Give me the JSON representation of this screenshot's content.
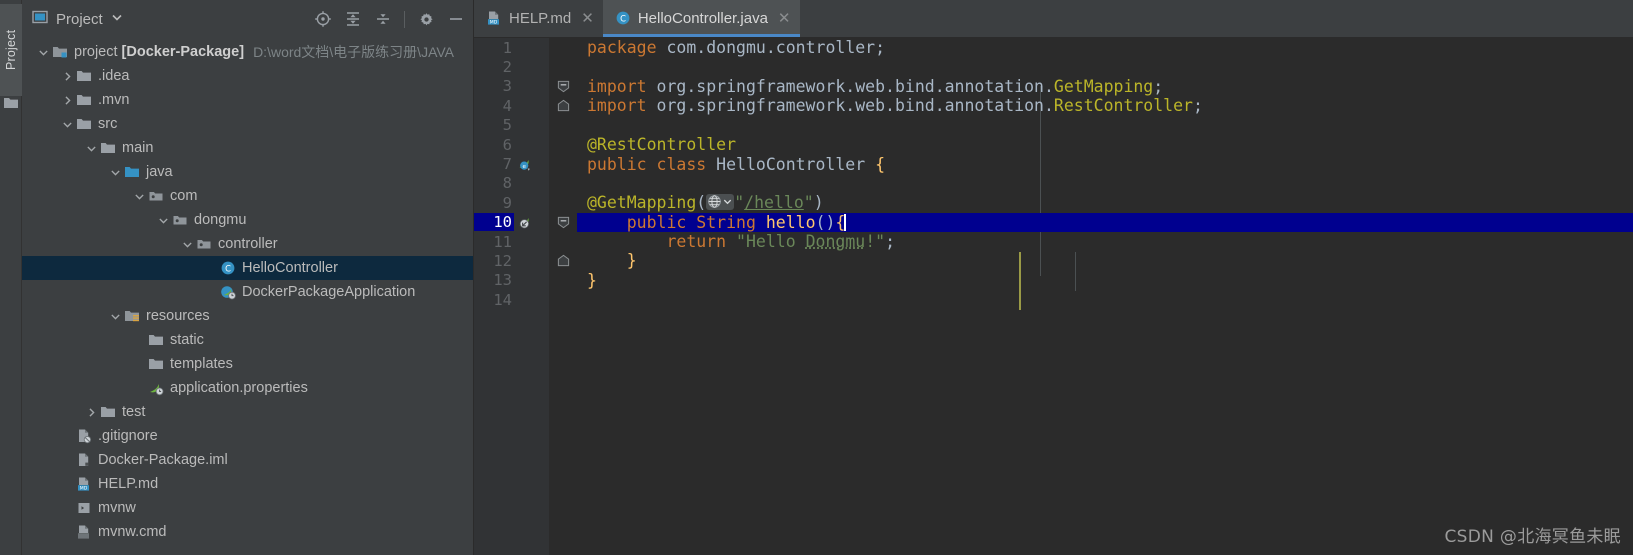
{
  "tool_strip": {
    "label": "Project",
    "icon": "folder-icon"
  },
  "panel": {
    "title": "Project",
    "title_icon": "project-view-icon",
    "dropdown_icon": "chevron-down-icon",
    "toolbar": [
      {
        "name": "locate-file-icon",
        "tip": "Select Opened File"
      },
      {
        "name": "expand-all-icon",
        "tip": "Expand All"
      },
      {
        "name": "collapse-all-icon",
        "tip": "Collapse All"
      },
      {
        "name": "settings-gear-icon",
        "tip": "Settings"
      },
      {
        "name": "hide-panel-icon",
        "tip": "Hide"
      }
    ]
  },
  "tree": [
    {
      "indent": 0,
      "arrow": "down",
      "icon": "module-icon",
      "label": "project",
      "bold": "[Docker-Package]",
      "sub": "D:\\word文档\\电子版练习册\\JAVA",
      "selected": false
    },
    {
      "indent": 1,
      "arrow": "right",
      "icon": "folder-icon",
      "label": ".idea",
      "selected": false
    },
    {
      "indent": 1,
      "arrow": "right",
      "icon": "folder-icon",
      "label": ".mvn",
      "selected": false
    },
    {
      "indent": 1,
      "arrow": "down",
      "icon": "folder-icon",
      "label": "src",
      "selected": false
    },
    {
      "indent": 2,
      "arrow": "down",
      "icon": "folder-icon",
      "label": "main",
      "selected": false
    },
    {
      "indent": 3,
      "arrow": "down",
      "icon": "source-root-icon",
      "label": "java",
      "selected": false
    },
    {
      "indent": 4,
      "arrow": "down",
      "icon": "package-icon",
      "label": "com",
      "selected": false
    },
    {
      "indent": 5,
      "arrow": "down",
      "icon": "package-icon",
      "label": "dongmu",
      "selected": false
    },
    {
      "indent": 6,
      "arrow": "down",
      "icon": "package-icon",
      "label": "controller",
      "selected": false
    },
    {
      "indent": 7,
      "arrow": "none",
      "icon": "java-class-icon",
      "label": "HelloController",
      "selected": true
    },
    {
      "indent": 7,
      "arrow": "none",
      "icon": "spring-boot-class-icon",
      "label": "DockerPackageApplication",
      "selected": false
    },
    {
      "indent": 3,
      "arrow": "down",
      "icon": "resource-root-icon",
      "label": "resources",
      "selected": false
    },
    {
      "indent": 4,
      "arrow": "none",
      "icon": "folder-icon",
      "label": "static",
      "selected": false
    },
    {
      "indent": 4,
      "arrow": "none",
      "icon": "folder-icon",
      "label": "templates",
      "selected": false
    },
    {
      "indent": 4,
      "arrow": "none",
      "icon": "spring-properties-icon",
      "label": "application.properties",
      "selected": false
    },
    {
      "indent": 2,
      "arrow": "right",
      "icon": "folder-icon",
      "label": "test",
      "selected": false
    },
    {
      "indent": 1,
      "arrow": "none",
      "icon": "gitignore-file-icon",
      "label": ".gitignore",
      "selected": false
    },
    {
      "indent": 1,
      "arrow": "none",
      "icon": "iml-file-icon",
      "label": "Docker-Package.iml",
      "selected": false
    },
    {
      "indent": 1,
      "arrow": "none",
      "icon": "markdown-file-icon",
      "label": "HELP.md",
      "selected": false
    },
    {
      "indent": 1,
      "arrow": "none",
      "icon": "shell-script-icon",
      "label": "mvnw",
      "selected": false
    },
    {
      "indent": 1,
      "arrow": "none",
      "icon": "cmd-file-icon",
      "label": "mvnw.cmd",
      "selected": false
    }
  ],
  "tabs": [
    {
      "label": "HELP.md",
      "icon": "markdown-file-icon",
      "close_icon": "close-icon",
      "active": false
    },
    {
      "label": "HelloController.java",
      "icon": "java-class-icon",
      "close_icon": "close-icon",
      "active": true
    }
  ],
  "editor": {
    "file": "HelloController.java",
    "highlighted_line": 10,
    "caret_line": 10,
    "total_lines": 14,
    "lines": [
      {
        "n": 1,
        "gutter": null,
        "fold": null,
        "text": "package com.dongmu.controller;"
      },
      {
        "n": 2,
        "gutter": null,
        "fold": null,
        "text": ""
      },
      {
        "n": 3,
        "gutter": null,
        "fold": "open",
        "text": "import org.springframework.web.bind.annotation.GetMapping;"
      },
      {
        "n": 4,
        "gutter": null,
        "fold": "end",
        "text": "import org.springframework.web.bind.annotation.RestController;"
      },
      {
        "n": 5,
        "gutter": null,
        "fold": null,
        "text": ""
      },
      {
        "n": 6,
        "gutter": null,
        "fold": null,
        "text": "@RestController"
      },
      {
        "n": 7,
        "gutter": "spring-bean-icon",
        "fold": null,
        "text": "public class HelloController {"
      },
      {
        "n": 8,
        "gutter": null,
        "fold": null,
        "text": ""
      },
      {
        "n": 9,
        "gutter": null,
        "fold": null,
        "text": "    @GetMapping(\"/hello\")",
        "inline_hint": "web-globe-icon"
      },
      {
        "n": 10,
        "gutter": "spring-mapping-icon",
        "fold": "open",
        "text": "    public String hello(){"
      },
      {
        "n": 11,
        "gutter": null,
        "fold": null,
        "text": "        return \"Hello Dongmu!\";"
      },
      {
        "n": 12,
        "gutter": null,
        "fold": "end",
        "text": "    }"
      },
      {
        "n": 13,
        "gutter": null,
        "fold": null,
        "text": "}"
      },
      {
        "n": 14,
        "gutter": null,
        "fold": null,
        "text": ""
      }
    ]
  },
  "watermark": "CSDN @北海冥鱼未眠",
  "colors": {
    "panel_bg": "#3c3f41",
    "editor_bg": "#2b2b2b",
    "gutter_bg": "#313335",
    "selection_tree": "#0d293e",
    "selection_line": "#00008f",
    "tab_active_underline": "#4a88c7",
    "keyword": "#cc7832",
    "string": "#6a8759",
    "annotation": "#bbb529",
    "method": "#ffc66d",
    "text": "#a9b7c6"
  }
}
